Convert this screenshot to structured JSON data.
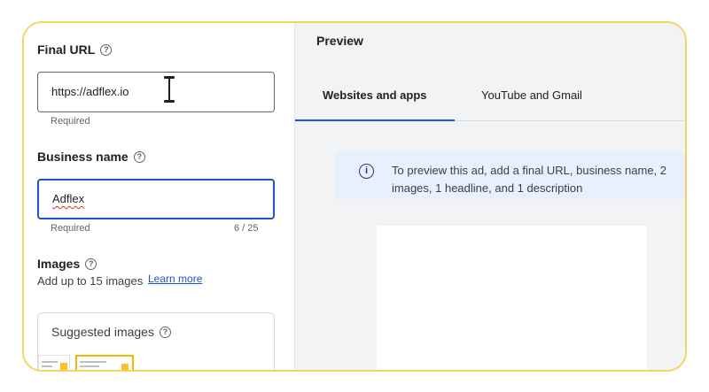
{
  "form": {
    "final_url": {
      "label": "Final URL",
      "value": "https://adflex.io",
      "hint": "Required"
    },
    "business_name": {
      "label": "Business name",
      "value": "Adflex",
      "hint": "Required",
      "count": "6 / 25"
    },
    "images": {
      "label": "Images",
      "subtitle": "Add up to 15 images",
      "learn_more": "Learn more"
    },
    "suggested": {
      "title": "Suggested images"
    }
  },
  "preview": {
    "title": "Preview",
    "tabs": [
      "Websites and apps",
      "YouTube and Gmail"
    ],
    "message": "To preview this ad, add a final URL, business name, 2 images, 1 headline, and 1 description"
  },
  "icons": {
    "help": "help-circle-icon",
    "info": "info-icon"
  },
  "colors": {
    "accent": "#1a56c9",
    "frame": "#f4d35e",
    "info_bg": "#e8f0fe"
  }
}
